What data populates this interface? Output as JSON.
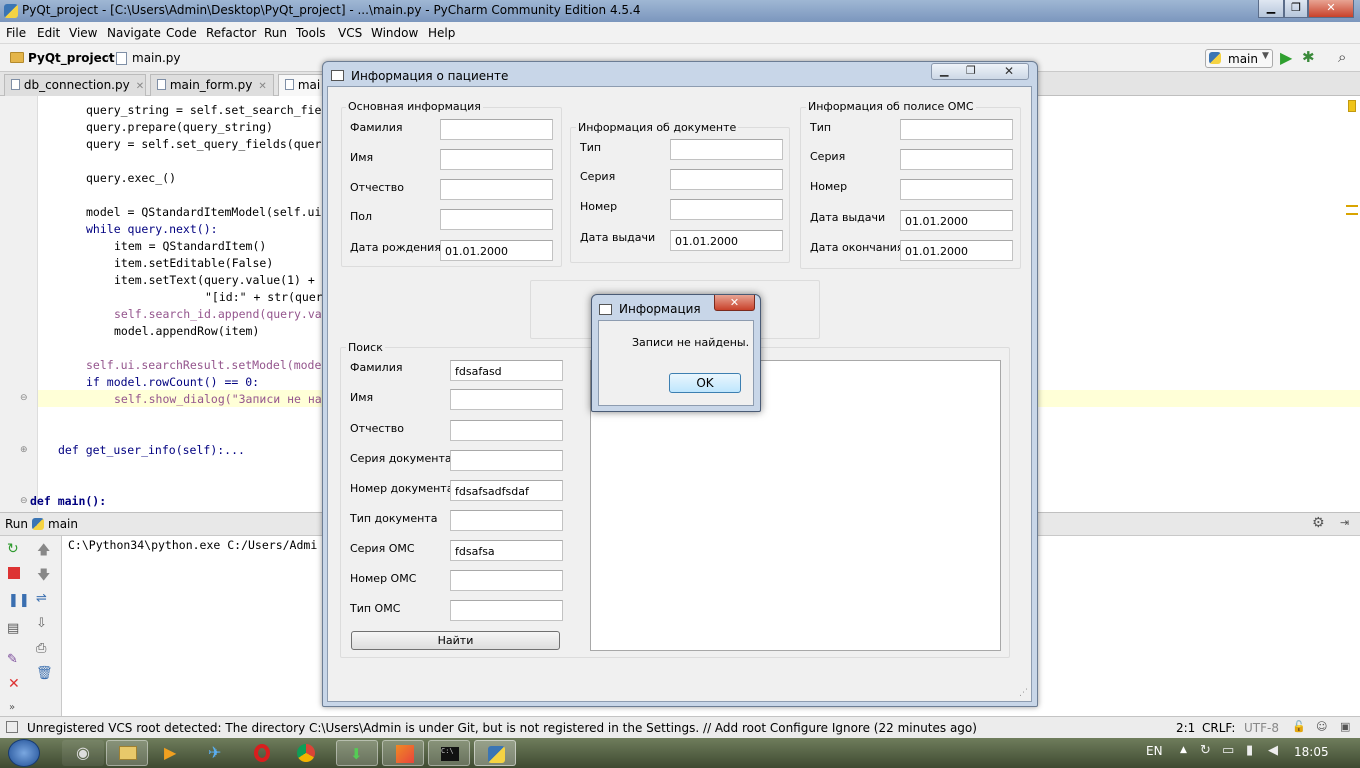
{
  "window_title": "PyQt_project - [C:\\Users\\Admin\\Desktop\\PyQt_project] - ...\\main.py - PyCharm Community Edition 4.5.4",
  "menu": [
    "File",
    "Edit",
    "View",
    "Navigate",
    "Code",
    "Refactor",
    "Run",
    "Tools",
    "VCS",
    "Window",
    "Help"
  ],
  "breadcrumb": {
    "project": "PyQt_project",
    "file": "main.py"
  },
  "run_config": "main",
  "tabs": [
    "db_connection.py",
    "main_form.py",
    "mai"
  ],
  "code_lines": [
    "query_string = self.set_search_fie",
    "query.prepare(query_string)",
    "query = self.set_query_fields(quer",
    "query.exec_()",
    "model = QStandardItemModel(self.ui",
    "while query.next():",
    "item = QStandardItem()",
    "item.setEditable(False)",
    "item.setText(query.value(1) + ",
    "\"[id:\" + str(quer",
    "self.search_id.append(query.va",
    "model.appendRow(item)",
    "self.ui.searchResult.setModel(mode",
    "if model.rowCount() == 0:",
    "self.show_dialog(\"Записи не на",
    "def get_user_info(self):...",
    "def main():"
  ],
  "run_panel": {
    "label": "Run",
    "config": "main",
    "console": "C:\\Python34\\python.exe C:/Users/Admi"
  },
  "status_bar": {
    "message": "Unregistered VCS root detected: The directory C:\\Users\\Admin is under Git, but is not registered in the Settings. // Add root  Configure  Ignore (22 minutes ago)",
    "position": "2:1",
    "line_sep": "CRLF:",
    "encoding": "UTF-8"
  },
  "taskbar": {
    "lang": "EN",
    "time": "18:05"
  },
  "patient_window": {
    "title": "Информация о пациенте",
    "basic": {
      "title": "Основная информация",
      "fields": [
        {
          "label": "Фамилия",
          "value": ""
        },
        {
          "label": "Имя",
          "value": ""
        },
        {
          "label": "Отчество",
          "value": ""
        },
        {
          "label": "Пол",
          "value": ""
        },
        {
          "label": "Дата рождения",
          "value": "01.01.2000"
        }
      ]
    },
    "document": {
      "title": "Информация об документе",
      "fields": [
        {
          "label": "Тип",
          "value": ""
        },
        {
          "label": "Серия",
          "value": ""
        },
        {
          "label": "Номер",
          "value": ""
        },
        {
          "label": "Дата выдачи",
          "value": "01.01.2000"
        }
      ]
    },
    "policy": {
      "title": "Информация об полисе ОМС",
      "fields": [
        {
          "label": "Тип",
          "value": ""
        },
        {
          "label": "Серия",
          "value": ""
        },
        {
          "label": "Номер",
          "value": ""
        },
        {
          "label": "Дата выдачи",
          "value": "01.01.2000"
        },
        {
          "label": "Дата окончания",
          "value": "01.01.2000"
        }
      ]
    },
    "search": {
      "title": "Поиск",
      "fields": [
        {
          "label": "Фамилия",
          "value": "fdsafasd"
        },
        {
          "label": "Имя",
          "value": ""
        },
        {
          "label": "Отчество",
          "value": ""
        },
        {
          "label": "Серия документа",
          "value": ""
        },
        {
          "label": "Номер документа",
          "value": "fdsafsadfsdaf"
        },
        {
          "label": "Тип документа",
          "value": ""
        },
        {
          "label": "Серия ОМС",
          "value": "fdsafsa"
        },
        {
          "label": "Номер ОМС",
          "value": ""
        },
        {
          "label": "Тип ОМС",
          "value": ""
        }
      ],
      "button": "Найти"
    }
  },
  "message_box": {
    "title": "Информация",
    "text": "Записи не найдены.",
    "ok": "OK"
  }
}
